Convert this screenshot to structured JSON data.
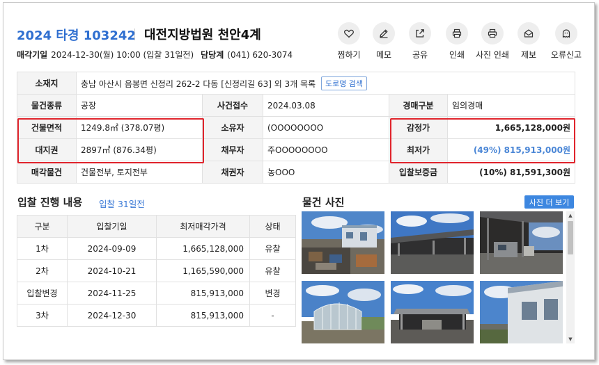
{
  "header": {
    "case_number": "2024 타경 103242",
    "court": "대전지방법원 천안4계",
    "sale_date_label": "매각기일",
    "sale_date_value": "2024-12-30(월) 10:00 (입찰 31일전)",
    "dept_label": "담당계",
    "dept_phone": "(041) 620-3074"
  },
  "actions": [
    {
      "label": "찜하기",
      "icon": "heart-icon"
    },
    {
      "label": "메모",
      "icon": "pencil-icon"
    },
    {
      "label": "공유",
      "icon": "share-icon"
    },
    {
      "label": "인쇄",
      "icon": "printer-icon"
    },
    {
      "label": "사진 인쇄",
      "icon": "photo-printer-icon"
    },
    {
      "label": "제보",
      "icon": "envelope-icon"
    },
    {
      "label": "오류신고",
      "icon": "ghost-icon"
    }
  ],
  "info": {
    "location_label": "소재지",
    "location_value": "충남 아산시 음봉면 신정리 262-2 다동 [신정리길 63] 외 3개 목록",
    "road_search_label": "도로명 검색",
    "type_label": "물건종류",
    "type_value": "공장",
    "filed_label": "사건접수",
    "filed_value": "2024.03.08",
    "auction_type_label": "경매구분",
    "auction_type_value": "임의경매",
    "building_area_label": "건물면적",
    "building_area_value": "1249.8㎡ (378.07평)",
    "owner_label": "소유자",
    "owner_value": "(OOOOOOOO",
    "appraisal_label": "감정가",
    "appraisal_value": "1,665,128,000원",
    "land_right_label": "대지권",
    "land_right_value": "2897㎡ (876.34평)",
    "debtor_label": "채무자",
    "debtor_value": "주OOOOOOOO",
    "min_price_label": "최저가",
    "min_price_value": "(49%) 815,913,000원",
    "sale_item_label": "매각물건",
    "sale_item_value": "건물전부, 토지전부",
    "creditor_label": "채권자",
    "creditor_value": "농OOO",
    "deposit_label": "입찰보증금",
    "deposit_value": "(10%) 81,591,300원"
  },
  "bids": {
    "title": "입찰 진행 내용",
    "subtitle": "입찰 31일전",
    "headers": [
      "구분",
      "입찰기일",
      "최저매각가격",
      "상태"
    ],
    "rows": [
      {
        "round": "1차",
        "date": "2024-09-09",
        "price": "1,665,128,000",
        "status": "유찰"
      },
      {
        "round": "2차",
        "date": "2024-10-21",
        "price": "1,165,590,000",
        "status": "유찰"
      },
      {
        "round": "입찰변경",
        "date": "2024-11-25",
        "price": "815,913,000",
        "status": "변경"
      },
      {
        "round": "3차",
        "date": "2024-12-30",
        "price": "815,913,000",
        "status": "-"
      }
    ]
  },
  "photos": {
    "title": "물건 사진",
    "more_label": "사진 더 보기"
  },
  "colors": {
    "brand_blue": "#2f6fd0",
    "link_blue": "#3b7ad6",
    "highlight_red": "#e0242c",
    "button_blue": "#3d87e0"
  }
}
